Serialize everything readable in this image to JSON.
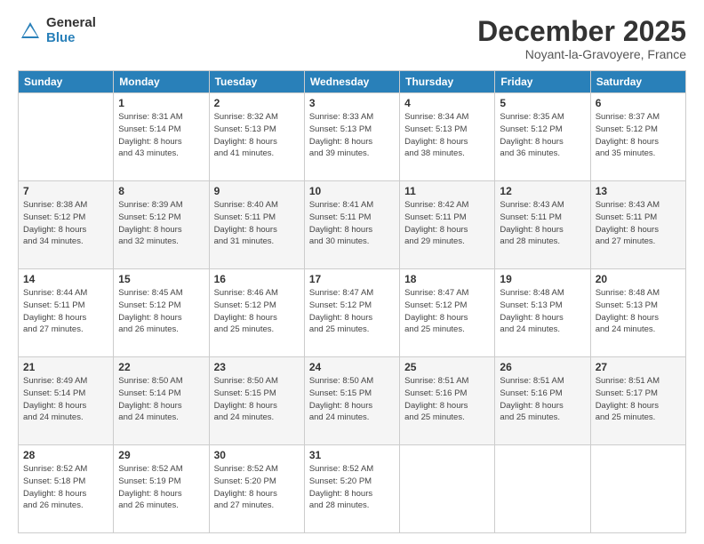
{
  "logo": {
    "general": "General",
    "blue": "Blue"
  },
  "header": {
    "month": "December 2025",
    "location": "Noyant-la-Gravoyere, France"
  },
  "weekdays": [
    "Sunday",
    "Monday",
    "Tuesday",
    "Wednesday",
    "Thursday",
    "Friday",
    "Saturday"
  ],
  "weeks": [
    [
      {
        "day": "",
        "info": ""
      },
      {
        "day": "1",
        "info": "Sunrise: 8:31 AM\nSunset: 5:14 PM\nDaylight: 8 hours\nand 43 minutes."
      },
      {
        "day": "2",
        "info": "Sunrise: 8:32 AM\nSunset: 5:13 PM\nDaylight: 8 hours\nand 41 minutes."
      },
      {
        "day": "3",
        "info": "Sunrise: 8:33 AM\nSunset: 5:13 PM\nDaylight: 8 hours\nand 39 minutes."
      },
      {
        "day": "4",
        "info": "Sunrise: 8:34 AM\nSunset: 5:13 PM\nDaylight: 8 hours\nand 38 minutes."
      },
      {
        "day": "5",
        "info": "Sunrise: 8:35 AM\nSunset: 5:12 PM\nDaylight: 8 hours\nand 36 minutes."
      },
      {
        "day": "6",
        "info": "Sunrise: 8:37 AM\nSunset: 5:12 PM\nDaylight: 8 hours\nand 35 minutes."
      }
    ],
    [
      {
        "day": "7",
        "info": "Sunrise: 8:38 AM\nSunset: 5:12 PM\nDaylight: 8 hours\nand 34 minutes."
      },
      {
        "day": "8",
        "info": "Sunrise: 8:39 AM\nSunset: 5:12 PM\nDaylight: 8 hours\nand 32 minutes."
      },
      {
        "day": "9",
        "info": "Sunrise: 8:40 AM\nSunset: 5:11 PM\nDaylight: 8 hours\nand 31 minutes."
      },
      {
        "day": "10",
        "info": "Sunrise: 8:41 AM\nSunset: 5:11 PM\nDaylight: 8 hours\nand 30 minutes."
      },
      {
        "day": "11",
        "info": "Sunrise: 8:42 AM\nSunset: 5:11 PM\nDaylight: 8 hours\nand 29 minutes."
      },
      {
        "day": "12",
        "info": "Sunrise: 8:43 AM\nSunset: 5:11 PM\nDaylight: 8 hours\nand 28 minutes."
      },
      {
        "day": "13",
        "info": "Sunrise: 8:43 AM\nSunset: 5:11 PM\nDaylight: 8 hours\nand 27 minutes."
      }
    ],
    [
      {
        "day": "14",
        "info": "Sunrise: 8:44 AM\nSunset: 5:11 PM\nDaylight: 8 hours\nand 27 minutes."
      },
      {
        "day": "15",
        "info": "Sunrise: 8:45 AM\nSunset: 5:12 PM\nDaylight: 8 hours\nand 26 minutes."
      },
      {
        "day": "16",
        "info": "Sunrise: 8:46 AM\nSunset: 5:12 PM\nDaylight: 8 hours\nand 25 minutes."
      },
      {
        "day": "17",
        "info": "Sunrise: 8:47 AM\nSunset: 5:12 PM\nDaylight: 8 hours\nand 25 minutes."
      },
      {
        "day": "18",
        "info": "Sunrise: 8:47 AM\nSunset: 5:12 PM\nDaylight: 8 hours\nand 25 minutes."
      },
      {
        "day": "19",
        "info": "Sunrise: 8:48 AM\nSunset: 5:13 PM\nDaylight: 8 hours\nand 24 minutes."
      },
      {
        "day": "20",
        "info": "Sunrise: 8:48 AM\nSunset: 5:13 PM\nDaylight: 8 hours\nand 24 minutes."
      }
    ],
    [
      {
        "day": "21",
        "info": "Sunrise: 8:49 AM\nSunset: 5:14 PM\nDaylight: 8 hours\nand 24 minutes."
      },
      {
        "day": "22",
        "info": "Sunrise: 8:50 AM\nSunset: 5:14 PM\nDaylight: 8 hours\nand 24 minutes."
      },
      {
        "day": "23",
        "info": "Sunrise: 8:50 AM\nSunset: 5:15 PM\nDaylight: 8 hours\nand 24 minutes."
      },
      {
        "day": "24",
        "info": "Sunrise: 8:50 AM\nSunset: 5:15 PM\nDaylight: 8 hours\nand 24 minutes."
      },
      {
        "day": "25",
        "info": "Sunrise: 8:51 AM\nSunset: 5:16 PM\nDaylight: 8 hours\nand 25 minutes."
      },
      {
        "day": "26",
        "info": "Sunrise: 8:51 AM\nSunset: 5:16 PM\nDaylight: 8 hours\nand 25 minutes."
      },
      {
        "day": "27",
        "info": "Sunrise: 8:51 AM\nSunset: 5:17 PM\nDaylight: 8 hours\nand 25 minutes."
      }
    ],
    [
      {
        "day": "28",
        "info": "Sunrise: 8:52 AM\nSunset: 5:18 PM\nDaylight: 8 hours\nand 26 minutes."
      },
      {
        "day": "29",
        "info": "Sunrise: 8:52 AM\nSunset: 5:19 PM\nDaylight: 8 hours\nand 26 minutes."
      },
      {
        "day": "30",
        "info": "Sunrise: 8:52 AM\nSunset: 5:20 PM\nDaylight: 8 hours\nand 27 minutes."
      },
      {
        "day": "31",
        "info": "Sunrise: 8:52 AM\nSunset: 5:20 PM\nDaylight: 8 hours\nand 28 minutes."
      },
      {
        "day": "",
        "info": ""
      },
      {
        "day": "",
        "info": ""
      },
      {
        "day": "",
        "info": ""
      }
    ]
  ]
}
